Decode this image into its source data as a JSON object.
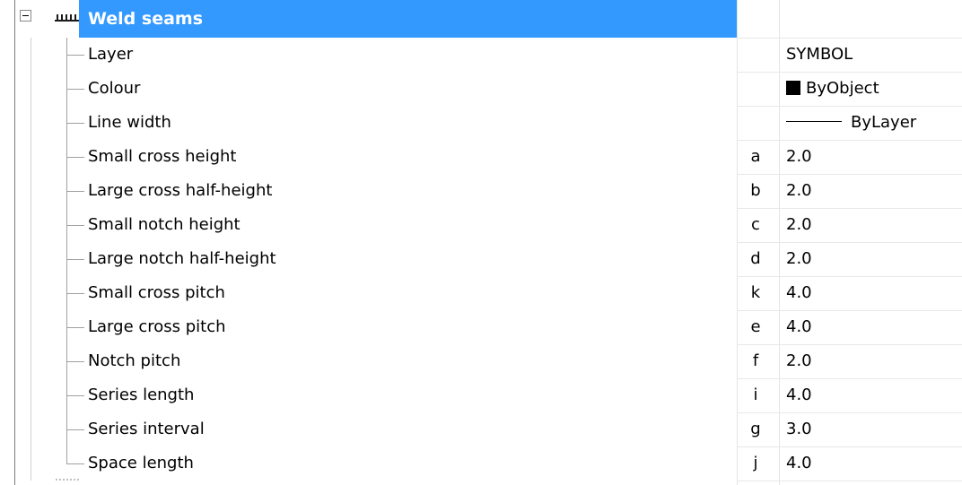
{
  "group": {
    "title": "Weld seams",
    "icon": "weld-seam-icon",
    "expander_icon": "collapse-minus-icon"
  },
  "properties": [
    {
      "label": "Layer",
      "tag": "",
      "value": "SYMBOL"
    },
    {
      "label": "Colour",
      "tag": "",
      "value": "ByObject",
      "swatch": "#000000"
    },
    {
      "label": "Line width",
      "tag": "",
      "value": "ByLayer"
    },
    {
      "label": "Small cross height",
      "tag": "a",
      "value": "2.0"
    },
    {
      "label": "Large cross half-height",
      "tag": "b",
      "value": "2.0"
    },
    {
      "label": "Small notch height",
      "tag": "c",
      "value": "2.0"
    },
    {
      "label": "Large notch half-height",
      "tag": "d",
      "value": "2.0"
    },
    {
      "label": "Small cross pitch",
      "tag": "k",
      "value": "4.0"
    },
    {
      "label": "Large cross pitch",
      "tag": "e",
      "value": "4.0"
    },
    {
      "label": "Notch pitch",
      "tag": "f",
      "value": "2.0"
    },
    {
      "label": "Series length",
      "tag": "i",
      "value": "4.0"
    },
    {
      "label": "Series interval",
      "tag": "g",
      "value": "3.0"
    },
    {
      "label": "Space length",
      "tag": "j",
      "value": "4.0"
    }
  ],
  "colors": {
    "selection": "#3399ff",
    "selection_text": "#ffffff"
  }
}
